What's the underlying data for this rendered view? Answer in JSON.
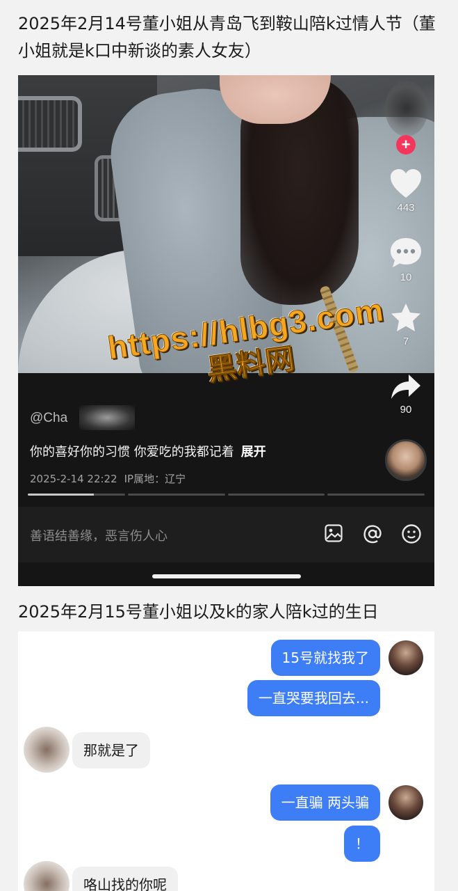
{
  "caption1": "2025年2月14号董小姐从青岛飞到鞍山陪k过情人节（董小姐就是k口中新谈的素人女友）",
  "caption2": "2025年2月15号董小姐以及k的家人陪k过的生日",
  "video": {
    "likes": "443",
    "comments": "10",
    "favorites": "7",
    "shares": "90",
    "handle": "@Cha",
    "description": "你的喜好你的习惯 你爱吃的我都记着",
    "expand_label": "展开",
    "date": "2025-2-14 22:22",
    "ip_location": "IP属地：辽宁",
    "progress_segments": [
      0.68,
      0,
      0,
      0
    ],
    "comment_placeholder": "善语结善缘，恶言伤人心",
    "icons": [
      "plus-icon",
      "heart-icon",
      "comment-icon",
      "star-icon",
      "share-icon",
      "image-icon",
      "at-icon",
      "emoji-icon"
    ]
  },
  "watermark": {
    "url": "https://hlbg3.com",
    "name": "黑料网",
    "color": "#f5a623"
  },
  "chat": {
    "messages": [
      {
        "sender": "me",
        "text": "15号就找我了"
      },
      {
        "sender": "me",
        "text": "一直哭要我回去..."
      },
      {
        "sender": "them",
        "text": "那就是了"
      },
      {
        "sender": "me",
        "text": "一直骗 两头骗"
      },
      {
        "sender": "me",
        "text": "！"
      },
      {
        "sender": "them",
        "text": "咯山找的你呢"
      }
    ],
    "bubble_color_me": "#3d7ef6",
    "bubble_color_them": "#f0f0f0"
  }
}
